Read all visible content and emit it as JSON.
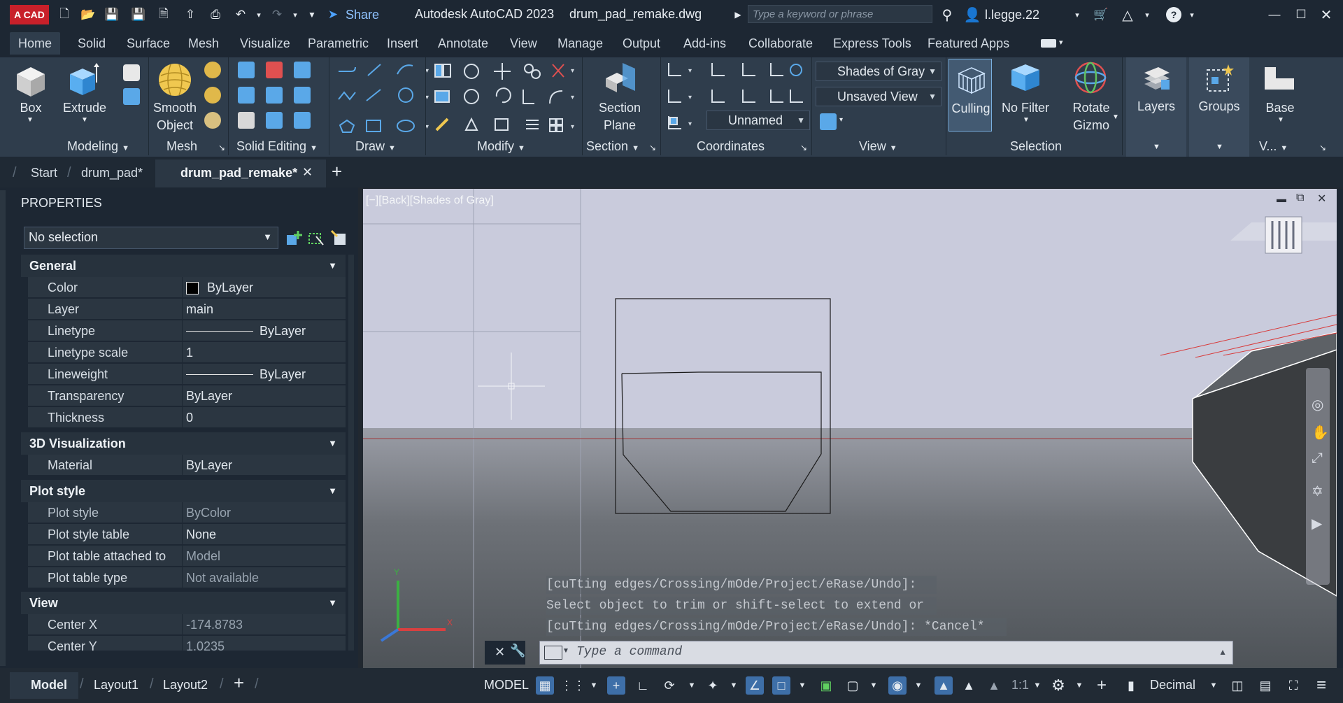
{
  "app": {
    "logo_text": "A CAD",
    "title": "Autodesk AutoCAD 2023",
    "file": "drum_pad_remake.dwg",
    "share_label": "Share",
    "search_placeholder": "Type a keyword or phrase",
    "user": "l.legge.22"
  },
  "menu_tabs": [
    "Home",
    "Solid",
    "Surface",
    "Mesh",
    "Visualize",
    "Parametric",
    "Insert",
    "Annotate",
    "View",
    "Manage",
    "Output",
    "Add-ins",
    "Collaborate",
    "Express Tools",
    "Featured Apps"
  ],
  "ribbon": {
    "buttons": {
      "box": "Box",
      "extrude": "Extrude",
      "smooth_object_1": "Smooth",
      "smooth_object_2": "Object",
      "section_plane_1": "Section",
      "section_plane_2": "Plane",
      "culling": "Culling",
      "no_filter": "No Filter",
      "rotate_gizmo_1": "Rotate",
      "rotate_gizmo_2": "Gizmo",
      "layers": "Layers",
      "groups": "Groups",
      "base": "Base"
    },
    "combos": {
      "visual_style": "Shades of Gray",
      "named_view": "Unsaved View",
      "ucs_name": "Unnamed"
    },
    "panels": {
      "modeling": "Modeling",
      "mesh": "Mesh",
      "solid_editing": "Solid Editing",
      "draw": "Draw",
      "modify": "Modify",
      "section": "Section",
      "coordinates": "Coordinates",
      "view": "View",
      "selection": "Selection",
      "view_short": "V..."
    }
  },
  "file_tabs": {
    "start": "Start",
    "tab1": "drum_pad*",
    "tab2": "drum_pad_remake*"
  },
  "properties": {
    "header": "PROPERTIES",
    "selection": "No selection",
    "sections": {
      "general": "General",
      "visualization": "3D Visualization",
      "plot_style": "Plot style",
      "view": "View"
    },
    "general": [
      {
        "k": "Color",
        "v": "ByLayer"
      },
      {
        "k": "Layer",
        "v": "main"
      },
      {
        "k": "Linetype",
        "v": "ByLayer"
      },
      {
        "k": "Linetype scale",
        "v": "1"
      },
      {
        "k": "Lineweight",
        "v": "ByLayer"
      },
      {
        "k": "Transparency",
        "v": "ByLayer"
      },
      {
        "k": "Thickness",
        "v": "0"
      }
    ],
    "visualization": [
      {
        "k": "Material",
        "v": "ByLayer"
      }
    ],
    "plot_style": [
      {
        "k": "Plot style",
        "v": "ByColor"
      },
      {
        "k": "Plot style table",
        "v": "None"
      },
      {
        "k": "Plot table attached to",
        "v": "Model"
      },
      {
        "k": "Plot table type",
        "v": "Not available"
      }
    ],
    "view": [
      {
        "k": "Center X",
        "v": "-174.8783"
      },
      {
        "k": "Center Y",
        "v": "1.0235"
      }
    ]
  },
  "viewport": {
    "label": "[−][Back][Shades of Gray]",
    "command_history": [
      "[cuTting edges/Crossing/mOde/Project/eRase/Undo]:",
      "Select object to trim or shift-select to extend or",
      "[cuTting edges/Crossing/mOde/Project/eRase/Undo]: *Cancel*"
    ],
    "command_placeholder": "Type a command"
  },
  "status": {
    "model_tab": "Model",
    "layout1": "Layout1",
    "layout2": "Layout2",
    "model_space": "MODEL",
    "scale": "1:1",
    "units": "Decimal"
  },
  "colors": {
    "brand": "#c8202a",
    "ribbon_bg": "#2f3d4c",
    "viewport_sky": "#c9cbdc",
    "viewport_ground": "#5e646a"
  }
}
